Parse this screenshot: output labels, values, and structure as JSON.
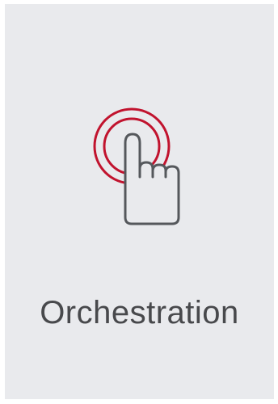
{
  "card": {
    "title": "Orchestration",
    "icon": "tap-hand-icon"
  },
  "colors": {
    "background": "#e9eaed",
    "accent": "#c1132e",
    "icon_stroke": "#55585c",
    "text": "#48494c"
  }
}
